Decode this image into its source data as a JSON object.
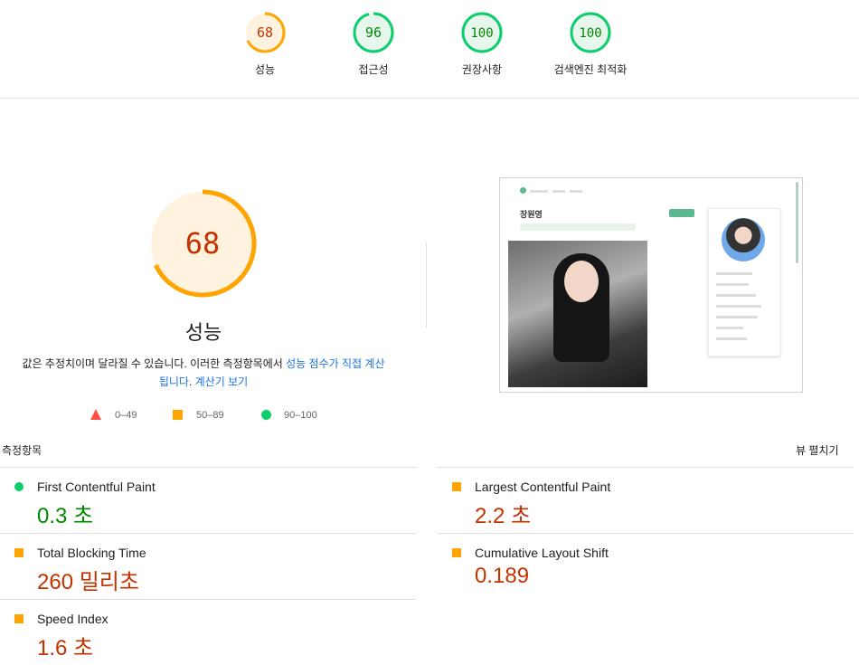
{
  "gauges": [
    {
      "score": "68",
      "label": "성능",
      "status": "average"
    },
    {
      "score": "96",
      "label": "접근성",
      "status": "pass"
    },
    {
      "score": "100",
      "label": "권장사항",
      "status": "pass"
    },
    {
      "score": "100",
      "label": "검색엔진 최적화",
      "status": "pass"
    }
  ],
  "summary": {
    "score": "68",
    "score_fraction": 0.68,
    "title": "성능",
    "desc_text": "값은 추정치이며 달라질 수 있습니다. 이러한 측정항목에서 ",
    "desc_link1": "성능 점수가 직접 계산됩니다",
    "desc_mid": ". ",
    "desc_link2": "계산기 보기"
  },
  "legend": [
    {
      "range": "0–49",
      "icon": "triangle-icon",
      "color": "#ff4e42"
    },
    {
      "range": "50–89",
      "icon": "square-icon",
      "color": "#ffa400"
    },
    {
      "range": "90–100",
      "icon": "circle-icon",
      "color": "#0cce6b"
    }
  ],
  "thumbnail": {
    "name": "장원영"
  },
  "metrics_header": {
    "title": "측정항목",
    "toggle": "뷰 펼치기"
  },
  "metrics": [
    {
      "name": "First Contentful Paint",
      "value": "0.3 초",
      "status": "pass"
    },
    {
      "name": "Largest Contentful Paint",
      "value": "2.2 초",
      "status": "average"
    },
    {
      "name": "Total Blocking Time",
      "value": "260 밀리초",
      "status": "average"
    },
    {
      "name": "Cumulative Layout Shift",
      "value": "0.189",
      "status": "average"
    },
    {
      "name": "Speed Index",
      "value": "1.6 초",
      "status": "average"
    }
  ],
  "colors": {
    "pass": "#0cce6b",
    "average": "#ffa400",
    "fail": "#ff4e42",
    "link": "#1a73e8"
  }
}
